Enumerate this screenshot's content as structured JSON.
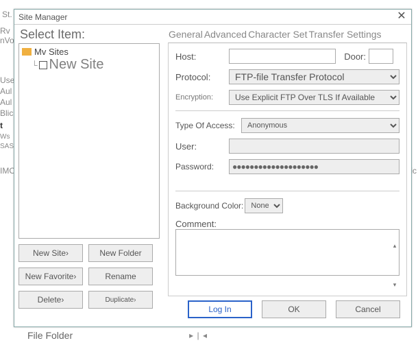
{
  "window": {
    "title": "Site Manager"
  },
  "bg": {
    "s1": "St.",
    "s2": "Rv",
    "s3": "nVo",
    "s4": "Use",
    "s5": "Aul",
    "s6": "Aul",
    "s7": "Blic",
    "s8": "t",
    "s9": "Ws",
    "s10": "SAS",
    "s11": "IMO",
    "s12": "fic"
  },
  "left": {
    "heading": "Select Item:",
    "root": "Mv Sites",
    "child": "New Site",
    "buttons": {
      "newsite": "New Site›",
      "newfolder": "New Folder",
      "newfav": "New Favorite›",
      "rename": "Rename",
      "delete": "Delete›",
      "dup": "Duplicate›"
    }
  },
  "tabs": {
    "general": "General",
    "advanced": "Advanced",
    "charset": "Character Set",
    "transfer": "Transfer Settings"
  },
  "form": {
    "host_label": "Host:",
    "host_value": "",
    "door_label": "Door:",
    "door_value": "",
    "protocol_label": "Protocol:",
    "protocol_value": "FTP-file Transfer Protocol",
    "enc_label": "Encryption:",
    "enc_value": "Use Explicit FTP Over TLS If Available",
    "access_label": "Type Of Access:",
    "access_value": "Anonymous",
    "user_label": "User:",
    "user_value": "",
    "pass_label": "Password:",
    "pass_value": "●●●●●●●●●●●●●●●●●●●●",
    "bg_label": "Background Color:",
    "bg_value": "None",
    "comment_label": "Comment:",
    "comment_value": ""
  },
  "footer": {
    "login": "Log In",
    "ok": "OK",
    "cancel": "Cancel"
  },
  "bottom": {
    "filetype": "File Folder",
    "arrows": "▸ | ◂"
  }
}
